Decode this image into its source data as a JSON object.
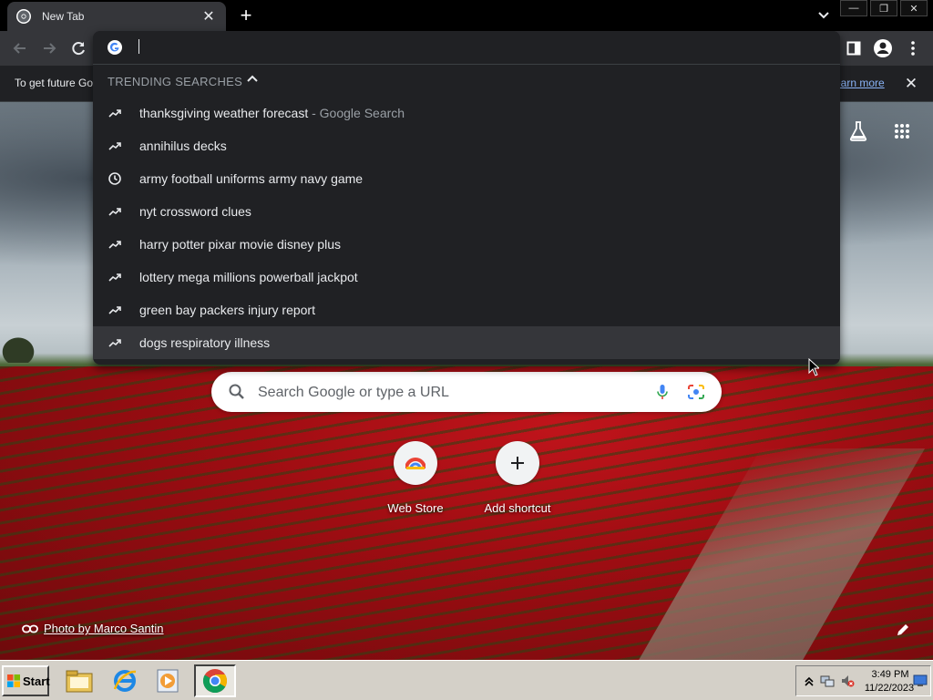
{
  "window": {
    "tab_title": "New Tab",
    "new_tab_label": "+",
    "minimize_label": "—",
    "restore_label": "❐",
    "close_label": "✕"
  },
  "toolbar": {
    "back_icon": "back-arrow-icon",
    "forward_icon": "forward-arrow-icon",
    "reload_icon": "reload-icon"
  },
  "infobar": {
    "text": "To get future Go",
    "learn_more": "earn more",
    "close_label": "✕"
  },
  "omnibox": {
    "input_value": "",
    "section_header": "TRENDING SEARCHES",
    "suggestions": [
      {
        "text": "thanksgiving weather forecast",
        "description": " - Google Search",
        "icon": "trending-icon"
      },
      {
        "text": "annihilus decks",
        "description": "",
        "icon": "trending-icon"
      },
      {
        "text": "army football uniforms army navy game",
        "description": "",
        "icon": "history-clock-icon"
      },
      {
        "text": "nyt crossword clues",
        "description": "",
        "icon": "trending-icon"
      },
      {
        "text": "harry potter pixar movie disney plus",
        "description": "",
        "icon": "trending-icon"
      },
      {
        "text": "lottery mega millions powerball jackpot",
        "description": "",
        "icon": "trending-icon"
      },
      {
        "text": "green bay packers injury report",
        "description": "",
        "icon": "trending-icon"
      },
      {
        "text": "dogs respiratory illness",
        "description": "",
        "icon": "trending-icon"
      }
    ],
    "selected_index": 7
  },
  "ntp": {
    "search_placeholder": "Search Google or type a URL",
    "shortcuts": [
      {
        "label": "Web Store",
        "icon": "web-store-icon"
      },
      {
        "label": "Add shortcut",
        "icon": "plus-icon"
      }
    ],
    "photo_credit": "Photo by Marco Santin"
  },
  "taskbar": {
    "start_label": "Start",
    "apps": [
      "file-explorer-icon",
      "internet-explorer-icon",
      "media-player-icon",
      "chrome-icon"
    ],
    "clock_time": "3:49 PM",
    "clock_date": "11/22/2023"
  },
  "colors": {
    "chrome_dark": "#202124",
    "toolbar": "#35363a",
    "link_blue": "#8ab4f8",
    "taskbar": "#d4d0c8"
  }
}
